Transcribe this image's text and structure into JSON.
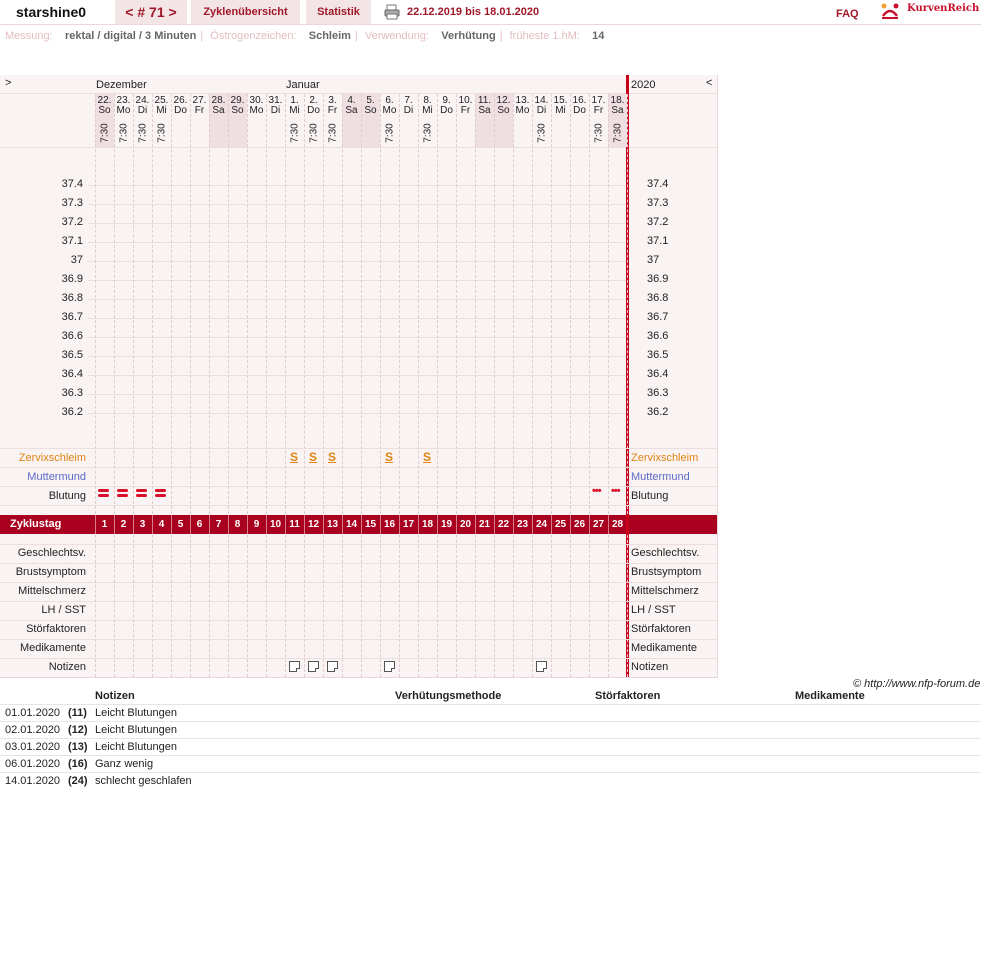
{
  "header": {
    "username": "starshine0",
    "cycle_nav": "< # 71 >",
    "tab_overview": "Zyklenübersicht",
    "tab_stats": "Statistik",
    "date_range": "22.12.2019 bis 18.01.2020",
    "faq": "FAQ",
    "brand": "KurvenReich"
  },
  "info": {
    "messung_label": "Messung:",
    "messung_value": "rektal / digital / 3 Minuten",
    "oestrogen_label": "Östrogenzeichen:",
    "oestrogen_value": "Schleim",
    "verwendung_label": "Verwendung:",
    "verwendung_value": "Verhütung",
    "fhm_label": "früheste 1.hM:",
    "fhm_value": "14"
  },
  "chart": {
    "nav_prev": ">",
    "nav_next": "<",
    "month_dec": "Dezember",
    "month_jan": "Januar",
    "year": "2020",
    "days": [
      {
        "d": "22.",
        "wd": "So",
        "time": "7:30",
        "we": true
      },
      {
        "d": "23.",
        "wd": "Mo",
        "time": "7:30",
        "we": false
      },
      {
        "d": "24.",
        "wd": "Di",
        "time": "7:30",
        "we": false
      },
      {
        "d": "25.",
        "wd": "Mi",
        "time": "7:30",
        "we": false
      },
      {
        "d": "26.",
        "wd": "Do",
        "time": "",
        "we": false
      },
      {
        "d": "27.",
        "wd": "Fr",
        "time": "",
        "we": false
      },
      {
        "d": "28.",
        "wd": "Sa",
        "time": "",
        "we": true
      },
      {
        "d": "29.",
        "wd": "So",
        "time": "",
        "we": true
      },
      {
        "d": "30.",
        "wd": "Mo",
        "time": "",
        "we": false
      },
      {
        "d": "31.",
        "wd": "Di",
        "time": "",
        "we": false
      },
      {
        "d": "1.",
        "wd": "Mi",
        "time": "7:30",
        "we": false
      },
      {
        "d": "2.",
        "wd": "Do",
        "time": "7:30",
        "we": false
      },
      {
        "d": "3.",
        "wd": "Fr",
        "time": "7:30",
        "we": false
      },
      {
        "d": "4.",
        "wd": "Sa",
        "time": "",
        "we": true
      },
      {
        "d": "5.",
        "wd": "So",
        "time": "",
        "we": true
      },
      {
        "d": "6.",
        "wd": "Mo",
        "time": "7:30",
        "we": false
      },
      {
        "d": "7.",
        "wd": "Di",
        "time": "",
        "we": false
      },
      {
        "d": "8.",
        "wd": "Mi",
        "time": "7:30",
        "we": false
      },
      {
        "d": "9.",
        "wd": "Do",
        "time": "",
        "we": false
      },
      {
        "d": "10.",
        "wd": "Fr",
        "time": "",
        "we": false
      },
      {
        "d": "11.",
        "wd": "Sa",
        "time": "",
        "we": true
      },
      {
        "d": "12.",
        "wd": "So",
        "time": "",
        "we": true
      },
      {
        "d": "13.",
        "wd": "Mo",
        "time": "",
        "we": false
      },
      {
        "d": "14.",
        "wd": "Di",
        "time": "7:30",
        "we": false
      },
      {
        "d": "15.",
        "wd": "Mi",
        "time": "",
        "we": false
      },
      {
        "d": "16.",
        "wd": "Do",
        "time": "",
        "we": false
      },
      {
        "d": "17.",
        "wd": "Fr",
        "time": "7:30",
        "we": false
      },
      {
        "d": "18.",
        "wd": "Sa",
        "time": "7:30",
        "we": true
      }
    ],
    "temps": [
      "37.4",
      "37.3",
      "37.2",
      "37.1",
      "37",
      "36.9",
      "36.8",
      "36.7",
      "36.6",
      "36.5",
      "36.4",
      "36.3",
      "36.2"
    ],
    "row_zervix": "Zervixschleim",
    "row_muttermund": "Muttermund",
    "row_blutung": "Blutung",
    "zyklustag_label": "Zyklustag",
    "zyklustage": [
      "1",
      "2",
      "3",
      "4",
      "5",
      "6",
      "7",
      "8",
      "9",
      "10",
      "11",
      "12",
      "13",
      "14",
      "15",
      "16",
      "17",
      "18",
      "19",
      "20",
      "21",
      "22",
      "23",
      "24",
      "25",
      "26",
      "27",
      "28"
    ],
    "lower_rows": [
      "Geschlechtsv.",
      "Brustsymptom",
      "Mittelschmerz",
      "LH / SST",
      "Störfaktoren",
      "Medikamente",
      "Notizen"
    ],
    "schleim_days": [
      11,
      12,
      13,
      16,
      18
    ],
    "schleim_symbol": "S",
    "bleeding_strong_days": [
      1,
      2,
      3,
      4
    ],
    "bleeding_spot_days": [
      27,
      28
    ],
    "spot_symbol": "•••",
    "note_days": [
      11,
      12,
      13,
      16,
      24
    ],
    "colors": {
      "accent": "#a8001e",
      "zervix": "#e08414",
      "muttermund": "#5a6ac8",
      "blood": "#d8102a"
    }
  },
  "copyright": "© http://www.nfp-forum.de",
  "notes": {
    "col_notes": "Notizen",
    "col_method": "Verhütungsmethode",
    "col_stoer": "Störfaktoren",
    "col_med": "Medikamente",
    "rows": [
      {
        "date": "01.01.2020",
        "day": "(11)",
        "text": "Leicht Blutungen"
      },
      {
        "date": "02.01.2020",
        "day": "(12)",
        "text": "Leicht Blutungen"
      },
      {
        "date": "03.01.2020",
        "day": "(13)",
        "text": "Leicht Blutungen"
      },
      {
        "date": "06.01.2020",
        "day": "(16)",
        "text": "Ganz wenig"
      },
      {
        "date": "14.01.2020",
        "day": "(24)",
        "text": "schlecht geschlafen"
      }
    ]
  }
}
